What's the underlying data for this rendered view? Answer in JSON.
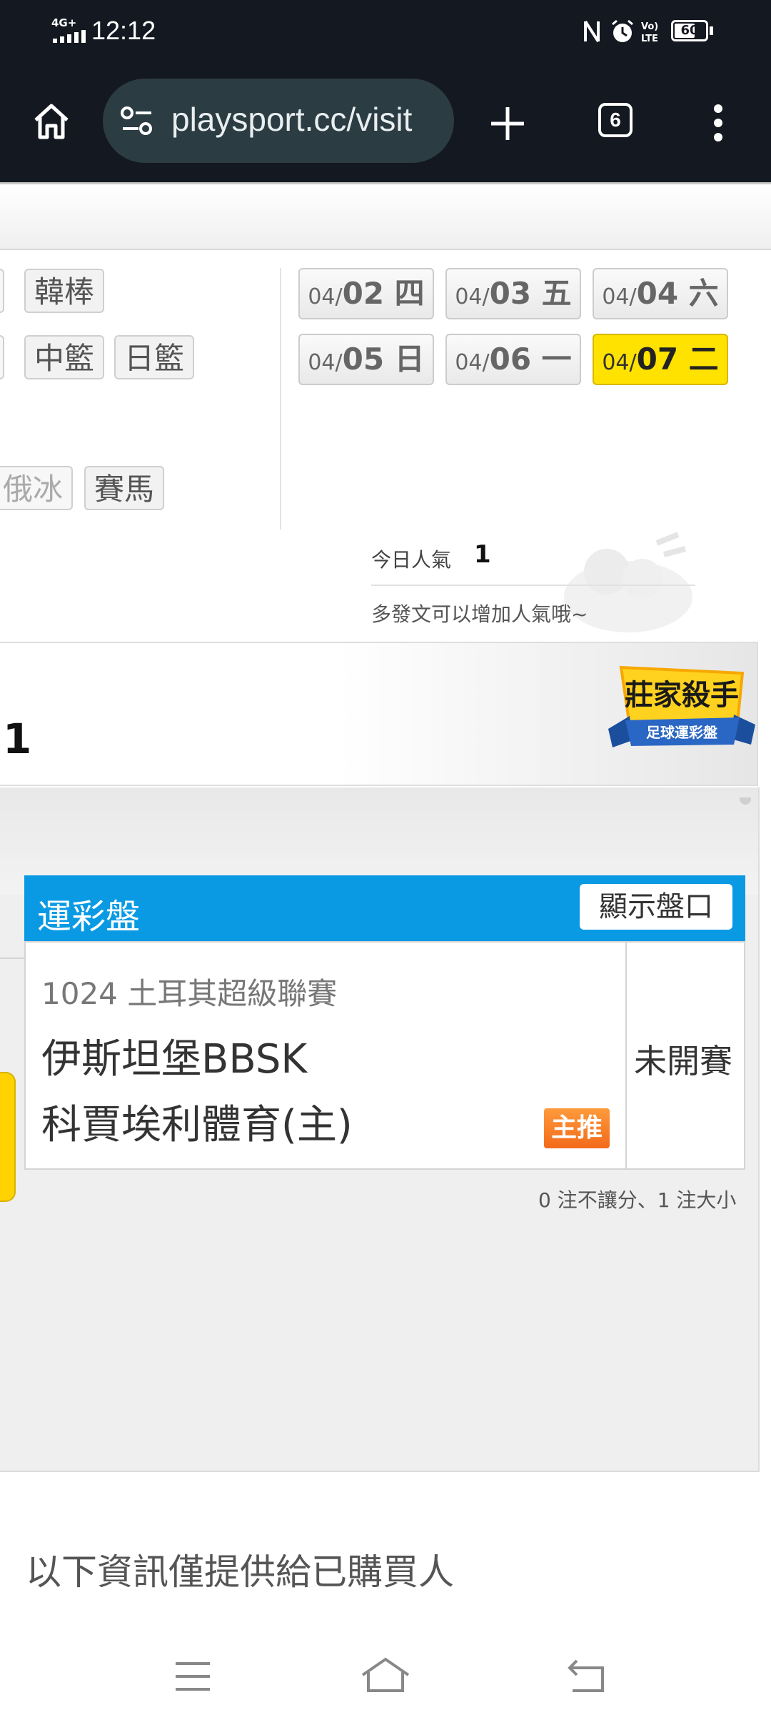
{
  "status_bar": {
    "time": "12:12",
    "network": "4G+",
    "battery": "60"
  },
  "browser": {
    "url": "playsport.cc/visit",
    "tab_count": "6"
  },
  "sport_tags": {
    "korea_baseball": "韓棒",
    "china_basketball": "中籃",
    "japan_basketball": "日籃",
    "russia_ice": "俄冰",
    "horse_racing": "賽馬"
  },
  "dates": [
    {
      "md": "04/",
      "day": "02 四",
      "active": false
    },
    {
      "md": "04/",
      "day": "03 五",
      "active": false
    },
    {
      "md": "04/",
      "day": "04 六",
      "active": false
    },
    {
      "md": "04/",
      "day": "05 日",
      "active": false
    },
    {
      "md": "04/",
      "day": "06 一",
      "active": false
    },
    {
      "md": "04/",
      "day": "07 二",
      "active": true
    }
  ],
  "popularity": {
    "label": "今日人氣",
    "value": "1",
    "hint": "多發文可以增加人氣哦~"
  },
  "banner": {
    "number": "1",
    "badge_title": "莊家殺手",
    "badge_subtitle": "足球運彩盤"
  },
  "odds_panel": {
    "title": "運彩盤",
    "show_button": "顯示盤口",
    "match": {
      "league": "1024 土耳其超級聯賽",
      "team_away": "伊斯坦堡BBSK",
      "team_home": "科賈埃利體育(主)",
      "badge": "主推",
      "status": "未開賽"
    },
    "bet_summary": "0 注不讓分、1 注大小"
  },
  "notice": "以下資訊僅提供給已購買人"
}
